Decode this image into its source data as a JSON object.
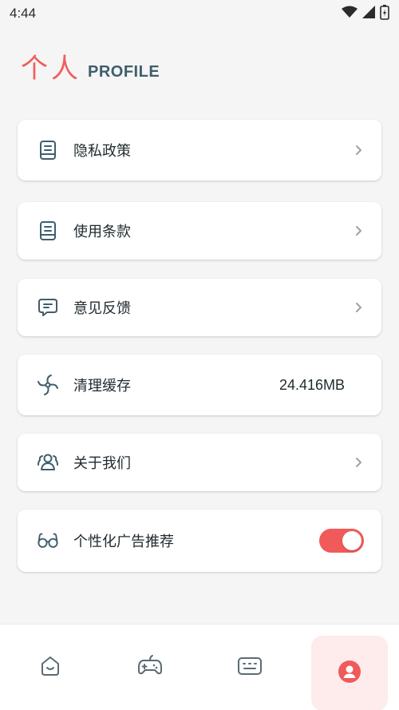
{
  "status_bar": {
    "time": "4:44"
  },
  "header": {
    "title_cn": "个人",
    "title_en": "PROFILE"
  },
  "menu": {
    "privacy": {
      "label": "隐私政策",
      "icon": "document-icon"
    },
    "terms": {
      "label": "使用条款",
      "icon": "document-icon"
    },
    "feedback": {
      "label": "意见反馈",
      "icon": "message-icon"
    },
    "cache": {
      "label": "清理缓存",
      "value": "24.416MB",
      "icon": "fan-icon"
    },
    "about": {
      "label": "关于我们",
      "icon": "users-icon"
    },
    "ads": {
      "label": "个性化广告推荐",
      "icon": "glasses-icon",
      "enabled": true
    }
  },
  "bottom_nav": {
    "items": [
      {
        "name": "home",
        "icon": "home-icon"
      },
      {
        "name": "games",
        "icon": "gamepad-icon"
      },
      {
        "name": "keyboard",
        "icon": "keyboard-icon"
      },
      {
        "name": "profile",
        "icon": "profile-icon",
        "active": true
      }
    ]
  },
  "colors": {
    "accent": "#f05a5a",
    "icon": "#3f5e6b",
    "background": "#f5f5f5",
    "active_tab_bg": "#fdeceb"
  }
}
